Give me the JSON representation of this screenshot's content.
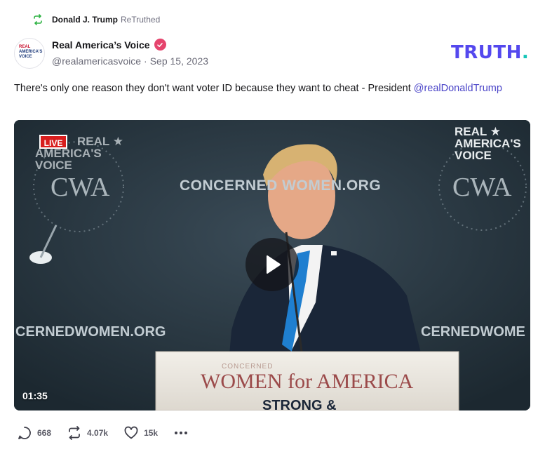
{
  "retruth": {
    "user": "Donald J. Trump",
    "label": "ReTruthed",
    "icon": "retruth-icon"
  },
  "post": {
    "author_name": "Real America’s Voice",
    "handle": "@realamericasvoice",
    "separator": "·",
    "date": "Sep 15, 2023",
    "text": "There's only one reason they don't want voter ID because they want to cheat - President ",
    "mention": "@realDonaldTrump",
    "avatar_text": [
      "REAL",
      "AMERICA'S",
      "VOICE"
    ]
  },
  "brand": {
    "logo_text": "TRUTH",
    "logo_dot": ".",
    "logo_color": "#5448ee",
    "dot_color": "#16c6b8"
  },
  "video": {
    "live_label": "LIVE",
    "duration": "01:35",
    "overlay_texts": {
      "corner_logo": [
        "REAL ★",
        "AMERICA'S",
        "VOICE"
      ],
      "backdrop_top": "CONCERNED WOMEN.ORG",
      "backdrop_bottom_left": "CERNEDWOMEN.ORG",
      "backdrop_bottom_right": "CERNEDWOME",
      "cwa": "CWA",
      "podium_small": "CONCERNED",
      "podium_main": "WOMEN for AMERICA",
      "podium_sub": "STRONG &"
    }
  },
  "actions": {
    "replies": "668",
    "retruths": "4.07k",
    "likes": "15k"
  },
  "colors": {
    "accent": "#5448ee",
    "verified": "#e5446d",
    "retruth_green": "#2fb344",
    "live_red": "#d81e1e"
  }
}
